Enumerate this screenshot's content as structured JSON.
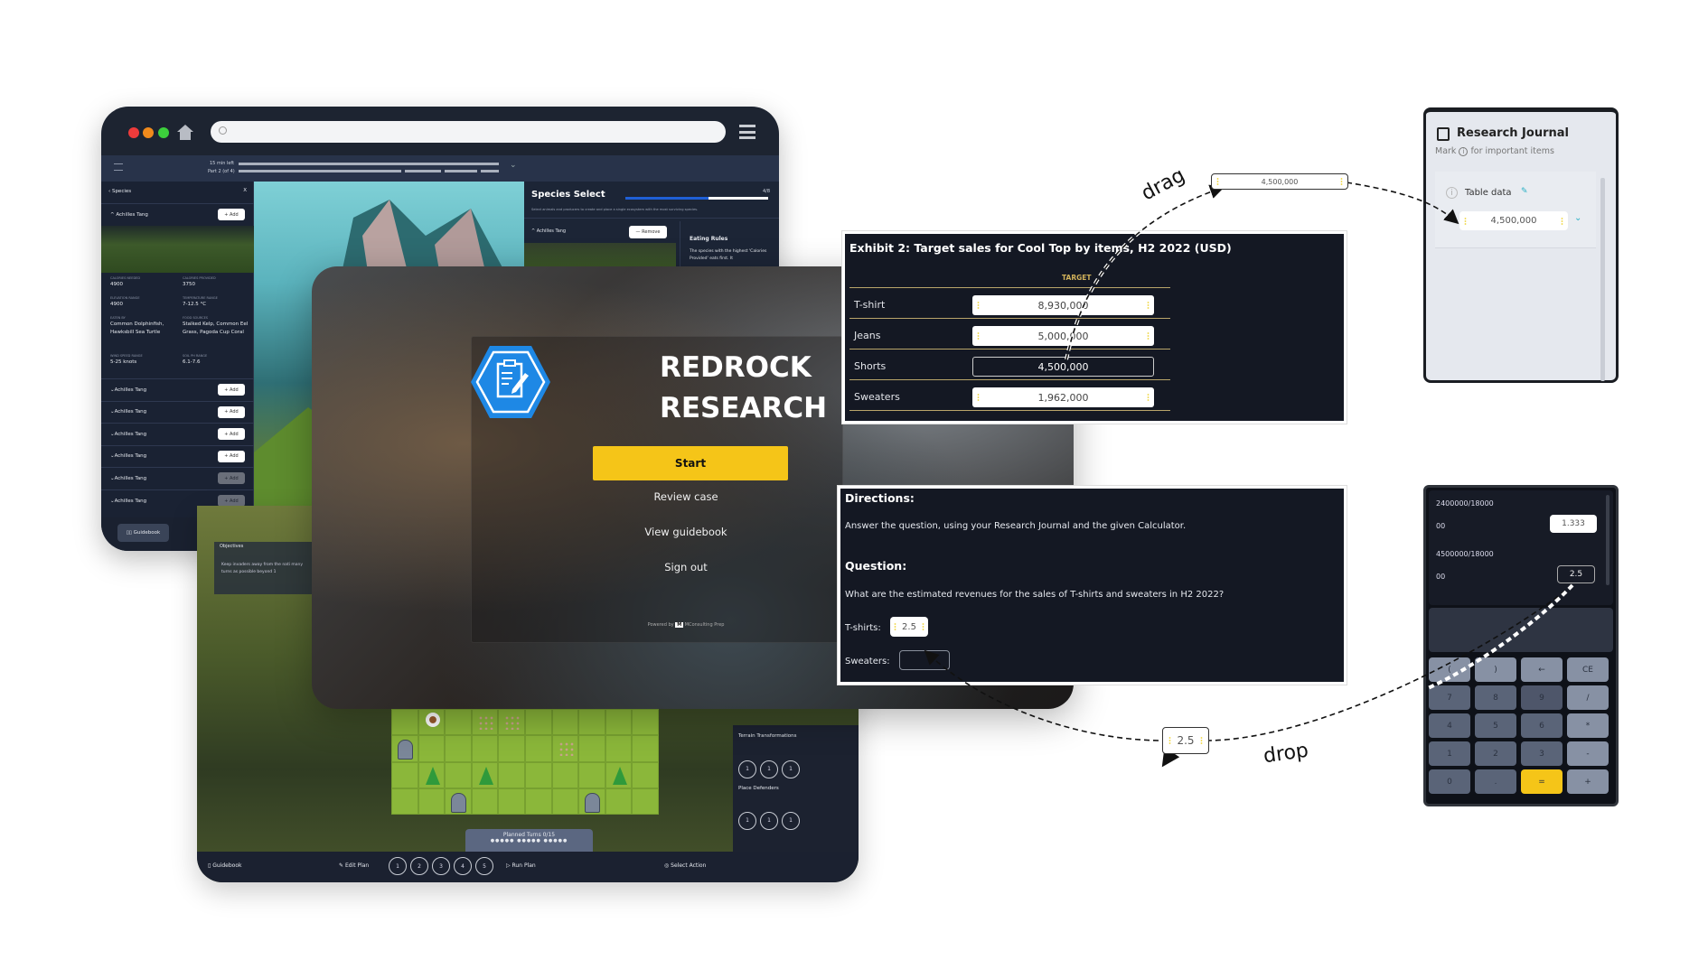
{
  "browser": {
    "timer": "15 min left",
    "part": "Part 2 (of 4)",
    "species_panel": {
      "title": "Species",
      "close": "X",
      "expanded_item": "Achilles Tang",
      "add_label": "+ Add",
      "stats": [
        {
          "label": "CALORIES NEEDED",
          "value": "4900"
        },
        {
          "label": "CALORIES PROVIDED",
          "value": "3750"
        },
        {
          "label": "ELEVATION RANGE",
          "value": "4900"
        },
        {
          "label": "TEMPERATURE RANGE",
          "value": "7-12.5 °C"
        },
        {
          "label": "EATEN BY",
          "value": "Common Dolphinfish, Hawksbill Sea Turtle"
        },
        {
          "label": "FOOD SOURCES",
          "value": "Stalked Kelp, Common Eel Grass, Pagoda Cup Coral"
        },
        {
          "label": "WIND SPEED RANGE",
          "value": "5-25 knots"
        },
        {
          "label": "SOIL PH RANGE",
          "value": "6.1-7.6"
        }
      ],
      "items": [
        "Achilles Tang",
        "Achilles Tang",
        "Achilles Tang",
        "Achilles Tang",
        "Achilles Tang",
        "Achilles Tang"
      ],
      "guidebook": "Guidebook"
    },
    "species_select": {
      "title": "Species Select",
      "progress_label": "4/8",
      "progress": 0.5,
      "subtitle": "Select animals and producers to create and place a single ecosystem with the most surviving species.",
      "item": "Achilles Tang",
      "remove_label": "— Remove",
      "rules_title": "Eating Rules",
      "rules_text": "The species with the highest 'Calories Provided' eats first. It"
    }
  },
  "game": {
    "objectives_title": "Objectives",
    "objective": "Keep invaders away from the nati many turns as possible beyond 1",
    "terrain_title": "Terrain Transformations",
    "terrain_values": [
      "1",
      "1",
      "1"
    ],
    "defenders_title": "Place Defenders",
    "defender_values": [
      "1",
      "1",
      "1"
    ],
    "planned_turns": "Planned Turns 0/15",
    "bottom": {
      "guidebook": "Guidebook",
      "edit_plan": "Edit Plan",
      "turns": [
        "1",
        "2",
        "3",
        "4",
        "5"
      ],
      "run_plan": "Run Plan",
      "select_action": "Select Action"
    },
    "grid_items": [
      {
        "row": 0,
        "col": 1,
        "type": "beaver"
      },
      {
        "row": 0,
        "col": 3,
        "type": "dirt"
      },
      {
        "row": 0,
        "col": 4,
        "type": "dirt"
      },
      {
        "row": 1,
        "col": 0,
        "type": "rock"
      },
      {
        "row": 1,
        "col": 6,
        "type": "dirt"
      },
      {
        "row": 2,
        "col": 1,
        "type": "tree"
      },
      {
        "row": 2,
        "col": 3,
        "type": "tree"
      },
      {
        "row": 2,
        "col": 8,
        "type": "tree"
      },
      {
        "row": 3,
        "col": 2,
        "type": "rock"
      },
      {
        "row": 3,
        "col": 7,
        "type": "rock"
      }
    ]
  },
  "login": {
    "brand_line1": "REDROCK",
    "brand_line2": "RESEARCH",
    "start": "Start",
    "review_case": "Review case",
    "view_guidebook": "View guidebook",
    "sign_out": "Sign out",
    "powered_by": "Powered by",
    "powered_brand": "MConsulting Prep",
    "accent": "#f5c518",
    "logo_color": "#1e88e5"
  },
  "exhibit": {
    "title": "Exhibit 2: Target sales for Cool Top by items, H2 2022 (USD)",
    "column": "TARGET",
    "rows": [
      {
        "label": "T-shirt",
        "value": "8,930,000"
      },
      {
        "label": "Jeans",
        "value": "5,000,000"
      },
      {
        "label": "Shorts",
        "value": "4,500,000"
      },
      {
        "label": "Sweaters",
        "value": "1,962,000"
      }
    ]
  },
  "question": {
    "directions_title": "Directions:",
    "directions": "Answer the question, using your Research Journal and the given Calculator.",
    "question_title": "Question:",
    "question": "What are the estimated revenues for the sales of T-shirts and sweaters in H2 2022?",
    "tshirts_label": "T-shirts:",
    "tshirts_value": "2.5",
    "sweaters_label": "Sweaters:",
    "sweaters_value": ""
  },
  "annotations": {
    "drag": "drag",
    "drop": "drop",
    "drag_chip": "4,500,000",
    "drop_chip": "2.5"
  },
  "journal": {
    "title": "Research Journal",
    "subtitle_pre": "Mark",
    "subtitle_post": "for important items",
    "section": "Table data",
    "entry": "4,500,000"
  },
  "calculator": {
    "history": [
      {
        "expr": "2400000/18000",
        "cont": "00",
        "result": "1.333"
      },
      {
        "expr": "4500000/18000",
        "cont": "00",
        "result": "2.5"
      }
    ],
    "display": "",
    "keys": [
      "(",
      ")",
      "←",
      "CE",
      "7",
      "8",
      "9",
      "/",
      "4",
      "5",
      "6",
      "*",
      "1",
      "2",
      "3",
      "-",
      "0",
      ".",
      "=",
      "+"
    ]
  }
}
